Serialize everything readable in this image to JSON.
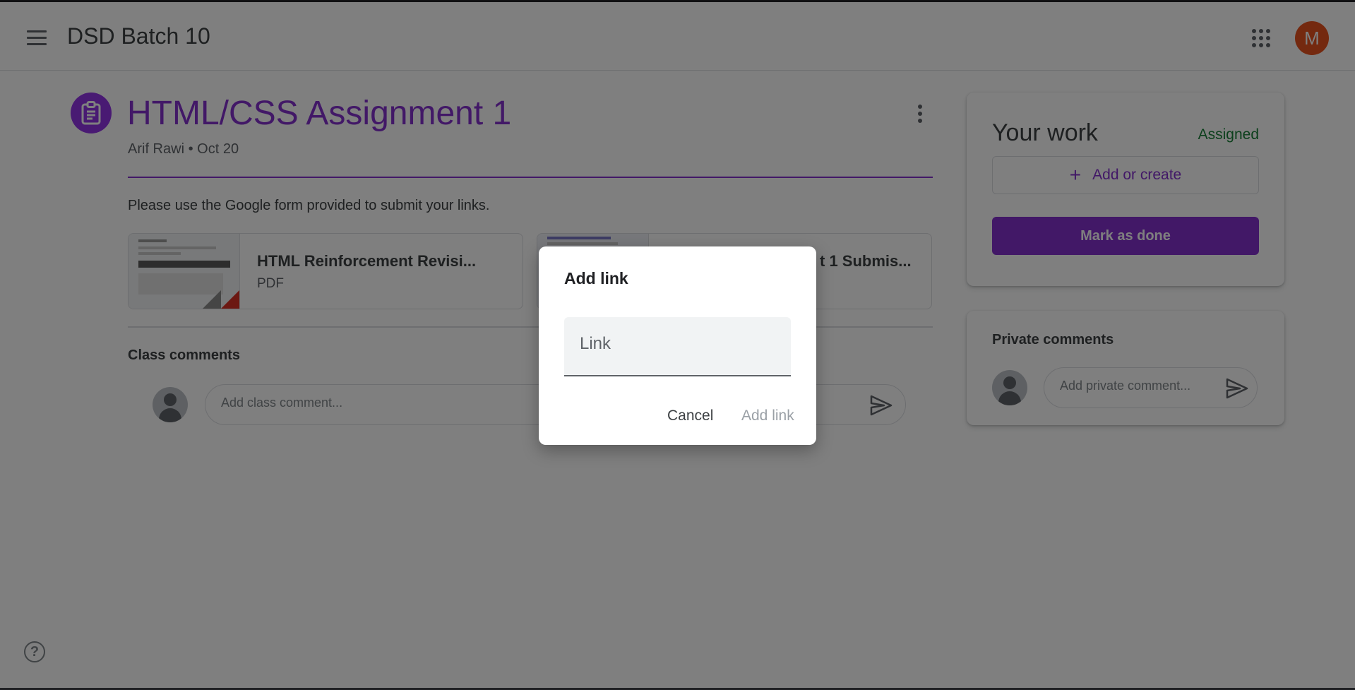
{
  "topbar": {
    "class_name": "DSD Batch 10",
    "account_initial": "M",
    "account_color": "#e8521f"
  },
  "assignment": {
    "title": "HTML/CSS Assignment 1",
    "author": "Arif Rawi",
    "separator": "•",
    "date": "Oct 20",
    "instructions": "Please use the Google form provided to submit your links.",
    "accent_color": "#8430ce"
  },
  "attachments": [
    {
      "name": "HTML Reinforcement Revisi...",
      "type": "PDF"
    },
    {
      "name": "t 1 Submis...",
      "type": ""
    }
  ],
  "class_comments": {
    "label": "Class comments",
    "placeholder": "Add class comment..."
  },
  "your_work": {
    "title": "Your work",
    "status": "Assigned",
    "status_color": "#188038",
    "add_label": "Add or create",
    "done_label": "Mark as done"
  },
  "private_comments": {
    "label": "Private comments",
    "placeholder": "Add private comment..."
  },
  "dialog": {
    "title": "Add link",
    "input_placeholder": "Link",
    "input_value": "",
    "cancel_label": "Cancel",
    "confirm_label": "Add link"
  },
  "help": {
    "symbol": "?"
  }
}
